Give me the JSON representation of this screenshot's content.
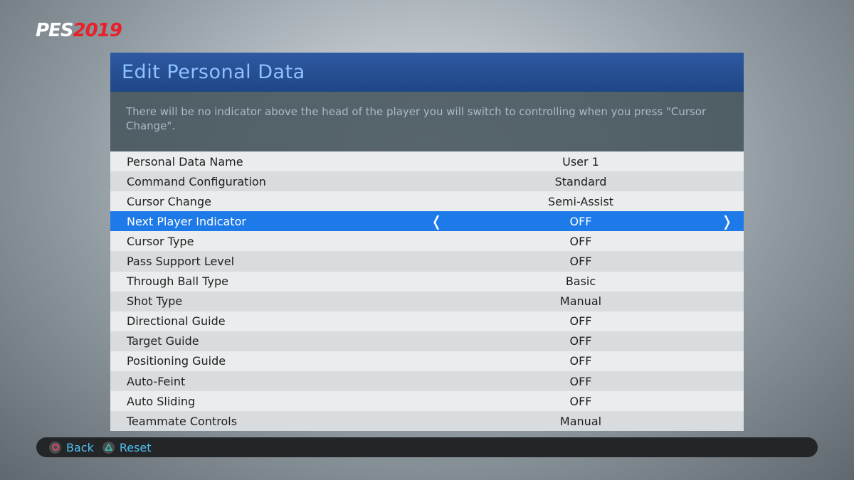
{
  "logo": {
    "brand": "PES",
    "year": "2019"
  },
  "panel": {
    "title": "Edit Personal Data",
    "description": "There will be no indicator above the head of the player you will switch to controlling when you press \"Cursor Change\"."
  },
  "settings": [
    {
      "label": "Personal Data Name",
      "value": "User 1"
    },
    {
      "label": "Command Configuration",
      "value": "Standard"
    },
    {
      "label": "Cursor Change",
      "value": "Semi-Assist"
    },
    {
      "label": "Next Player Indicator",
      "value": "OFF"
    },
    {
      "label": "Cursor Type",
      "value": "OFF"
    },
    {
      "label": "Pass Support Level",
      "value": "OFF"
    },
    {
      "label": "Through Ball Type",
      "value": "Basic"
    },
    {
      "label": "Shot Type",
      "value": "Manual"
    },
    {
      "label": "Directional Guide",
      "value": "OFF"
    },
    {
      "label": "Target Guide",
      "value": "OFF"
    },
    {
      "label": "Positioning Guide",
      "value": "OFF"
    },
    {
      "label": "Auto-Feint",
      "value": "OFF"
    },
    {
      "label": "Auto Sliding",
      "value": "OFF"
    },
    {
      "label": "Teammate Controls",
      "value": "Manual"
    }
  ],
  "selected_index": 3,
  "arrows": {
    "left": "❬",
    "right": "❭"
  },
  "footer": {
    "back": {
      "icon": "circle-button-icon",
      "label": "Back"
    },
    "reset": {
      "icon": "triangle-button-icon",
      "label": "Reset"
    }
  },
  "colors": {
    "selection": "#1e7ae8",
    "title": "#8ec1ff",
    "header": "#2a529a",
    "hint": "#4fc0f0",
    "logo_year": "#e8202a"
  }
}
